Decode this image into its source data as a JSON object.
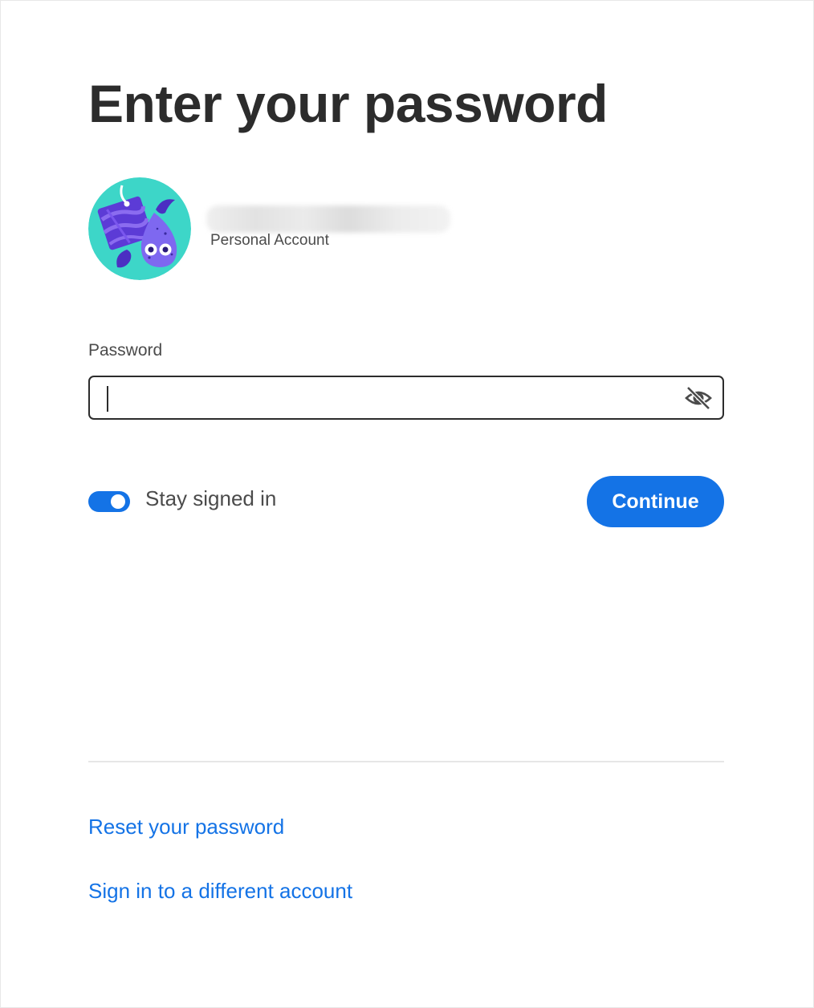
{
  "page": {
    "title": "Enter your password"
  },
  "account": {
    "email": "",
    "type": "Personal Account"
  },
  "password_field": {
    "label": "Password",
    "value": "",
    "visibility_icon": "eye-slash-icon"
  },
  "stay_signed_in": {
    "label": "Stay signed in",
    "enabled": true
  },
  "actions": {
    "continue_label": "Continue"
  },
  "links": {
    "reset_password": "Reset your password",
    "different_account": "Sign in to a different account"
  },
  "colors": {
    "accent": "#1473e6",
    "text": "#2c2c2c",
    "avatar_background": "#3dd6c8",
    "avatar_purple": "#5c3bd6"
  }
}
